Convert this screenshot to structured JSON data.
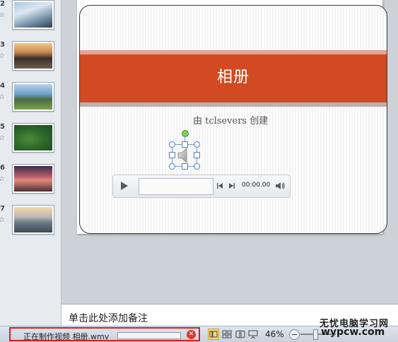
{
  "thumbnails": [
    {
      "num": "2",
      "star": "☆"
    },
    {
      "num": "3",
      "star": "☆"
    },
    {
      "num": "4",
      "star": "☆"
    },
    {
      "num": "5",
      "star": "☆"
    },
    {
      "num": "6",
      "star": "☆"
    },
    {
      "num": "7",
      "star": "☆"
    }
  ],
  "slide": {
    "title": "相册",
    "subtitle": "由 tclsevers 创建",
    "title_band_color": "#d24a22"
  },
  "player": {
    "time": "00:00.00",
    "play_icon": "play-icon",
    "prev_icon": "previous-icon",
    "next_icon": "next-icon",
    "volume_icon": "volume-icon"
  },
  "notes": {
    "placeholder": "单击此处添加备注"
  },
  "statusbar": {
    "video_label": "正在制作视频 相册.wmv",
    "zoom": "46%",
    "highlight_color": "#d32020"
  },
  "watermark": {
    "line1": "无忧电脑学习网",
    "line2": "wypcw.com"
  }
}
